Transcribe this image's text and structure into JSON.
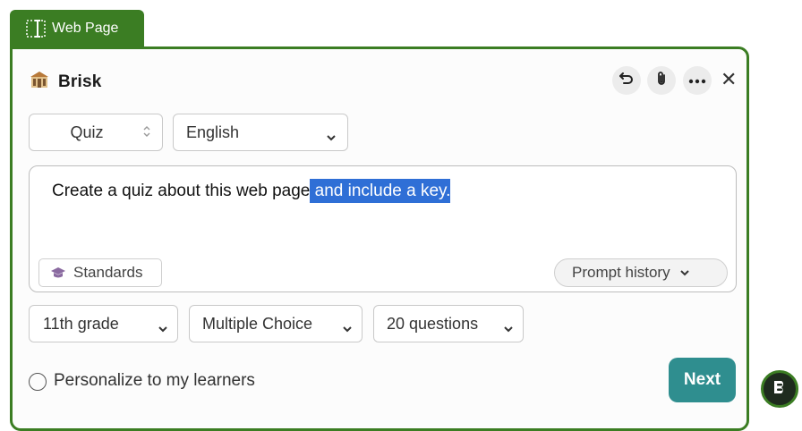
{
  "tab": {
    "label": "Web Page",
    "icon": "text-selection-icon"
  },
  "header": {
    "brand": "Brisk",
    "logo": "brisk-logo-icon"
  },
  "header_actions": [
    {
      "icon": "undo-icon"
    },
    {
      "icon": "paperclip-icon"
    },
    {
      "icon": "more-horizontal-icon"
    },
    {
      "icon": "close-icon",
      "label": "✕"
    }
  ],
  "controls": {
    "type": {
      "value": "Quiz"
    },
    "language": {
      "value": "English"
    }
  },
  "prompt": {
    "text_plain": "Create a quiz about this web page",
    "text_selected": " and include a key.",
    "selection_color": "#2f6fd6"
  },
  "chips": {
    "standards": "Standards",
    "prompt_history": "Prompt history"
  },
  "options": {
    "grade": "11th grade",
    "question_type": "Multiple Choice",
    "count": "20 questions"
  },
  "personalize": {
    "label": "Personalize to my learners",
    "checked": false
  },
  "next": {
    "label": "Next",
    "color": "#2f8e8f"
  },
  "colors": {
    "accent": "#3b7d23"
  }
}
